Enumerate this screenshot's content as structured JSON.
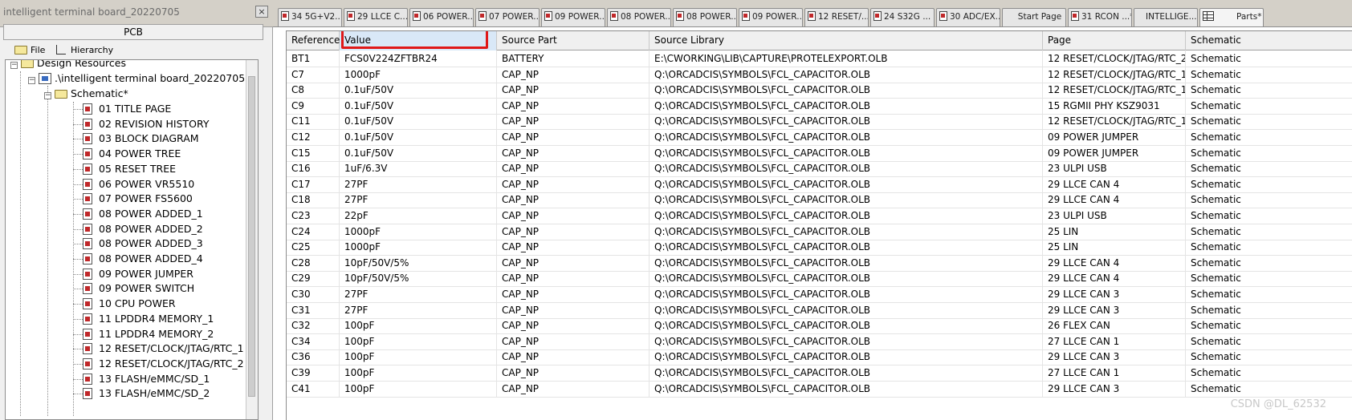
{
  "panel": {
    "title": "intelligent terminal board_20220705",
    "close_glyph": "×",
    "pcb_tab": "PCB",
    "tabs": {
      "file": "File",
      "hierarchy": "Hierarchy"
    }
  },
  "tree": {
    "design_resources": "Design Resources",
    "dsn": ".\\intelligent terminal board_20220705.dsn",
    "schematic": "Schematic*",
    "pages": [
      "01 TITLE PAGE",
      "02 REVISION HISTORY",
      "03 BLOCK DIAGRAM",
      "04 POWER TREE",
      "05 RESET TREE",
      "06 POWER VR5510",
      "07 POWER FS5600",
      "08 POWER ADDED_1",
      "08 POWER ADDED_2",
      "08 POWER ADDED_3",
      "08 POWER ADDED_4",
      "09 POWER JUMPER",
      "09 POWER SWITCH",
      "10 CPU POWER",
      "11 LPDDR4 MEMORY_1",
      "11 LPDDR4 MEMORY_2",
      "12 RESET/CLOCK/JTAG/RTC_1",
      "12 RESET/CLOCK/JTAG/RTC_2",
      "13 FLASH/eMMC/SD_1",
      "13 FLASH/eMMC/SD_2"
    ]
  },
  "doc_tabs": [
    {
      "label": "34 5G+V2...",
      "icon": true
    },
    {
      "label": "29 LLCE C...",
      "icon": true
    },
    {
      "label": "06 POWER...",
      "icon": true
    },
    {
      "label": "07 POWER...",
      "icon": true
    },
    {
      "label": "09 POWER...",
      "icon": true
    },
    {
      "label": "08 POWER...",
      "icon": true
    },
    {
      "label": "08 POWER...",
      "icon": true
    },
    {
      "label": "09 POWER...",
      "icon": true
    },
    {
      "label": "12 RESET/...",
      "icon": true
    },
    {
      "label": "24 S32G ...",
      "icon": true
    },
    {
      "label": "30 ADC/EX...",
      "icon": true
    },
    {
      "label": "Start Page",
      "icon": false
    },
    {
      "label": "31 RCON ...*",
      "icon": true
    },
    {
      "label": "INTELLIGE...*",
      "icon": false
    },
    {
      "label": "Parts*",
      "icon": false,
      "grid": true
    }
  ],
  "table": {
    "columns": [
      "Reference",
      "Value",
      "Source Part",
      "Source Library",
      "Page",
      "Schematic"
    ],
    "rows": [
      [
        "BT1",
        "FCS0V224ZFTBR24",
        "BATTERY",
        "E:\\CWORKING\\LIB\\CAPTURE\\PROTELEXPORT.OLB",
        "12 RESET/CLOCK/JTAG/RTC_2",
        "Schematic"
      ],
      [
        "C7",
        "1000pF",
        "CAP_NP",
        "Q:\\ORCADCIS\\SYMBOLS\\FCL_CAPACITOR.OLB",
        "12 RESET/CLOCK/JTAG/RTC_1",
        "Schematic"
      ],
      [
        "C8",
        "0.1uF/50V",
        "CAP_NP",
        "Q:\\ORCADCIS\\SYMBOLS\\FCL_CAPACITOR.OLB",
        "12 RESET/CLOCK/JTAG/RTC_1",
        "Schematic"
      ],
      [
        "C9",
        "0.1uF/50V",
        "CAP_NP",
        "Q:\\ORCADCIS\\SYMBOLS\\FCL_CAPACITOR.OLB",
        "15 RGMII PHY KSZ9031",
        "Schematic"
      ],
      [
        "C11",
        "0.1uF/50V",
        "CAP_NP",
        "Q:\\ORCADCIS\\SYMBOLS\\FCL_CAPACITOR.OLB",
        "12 RESET/CLOCK/JTAG/RTC_1",
        "Schematic"
      ],
      [
        "C12",
        "0.1uF/50V",
        "CAP_NP",
        "Q:\\ORCADCIS\\SYMBOLS\\FCL_CAPACITOR.OLB",
        "09 POWER JUMPER",
        "Schematic"
      ],
      [
        "C15",
        "0.1uF/50V",
        "CAP_NP",
        "Q:\\ORCADCIS\\SYMBOLS\\FCL_CAPACITOR.OLB",
        "09 POWER JUMPER",
        "Schematic"
      ],
      [
        "C16",
        "1uF/6.3V",
        "CAP_NP",
        "Q:\\ORCADCIS\\SYMBOLS\\FCL_CAPACITOR.OLB",
        "23 ULPI USB",
        "Schematic"
      ],
      [
        "C17",
        "27PF",
        "CAP_NP",
        "Q:\\ORCADCIS\\SYMBOLS\\FCL_CAPACITOR.OLB",
        "29 LLCE CAN 4",
        "Schematic"
      ],
      [
        "C18",
        "27PF",
        "CAP_NP",
        "Q:\\ORCADCIS\\SYMBOLS\\FCL_CAPACITOR.OLB",
        "29 LLCE CAN 4",
        "Schematic"
      ],
      [
        "C23",
        "22pF",
        "CAP_NP",
        "Q:\\ORCADCIS\\SYMBOLS\\FCL_CAPACITOR.OLB",
        "23 ULPI USB",
        "Schematic"
      ],
      [
        "C24",
        "1000pF",
        "CAP_NP",
        "Q:\\ORCADCIS\\SYMBOLS\\FCL_CAPACITOR.OLB",
        "25 LIN",
        "Schematic"
      ],
      [
        "C25",
        "1000pF",
        "CAP_NP",
        "Q:\\ORCADCIS\\SYMBOLS\\FCL_CAPACITOR.OLB",
        "25 LIN",
        "Schematic"
      ],
      [
        "C28",
        "10pF/50V/5%",
        "CAP_NP",
        "Q:\\ORCADCIS\\SYMBOLS\\FCL_CAPACITOR.OLB",
        "29 LLCE CAN 4",
        "Schematic"
      ],
      [
        "C29",
        "10pF/50V/5%",
        "CAP_NP",
        "Q:\\ORCADCIS\\SYMBOLS\\FCL_CAPACITOR.OLB",
        "29 LLCE CAN 4",
        "Schematic"
      ],
      [
        "C30",
        "27PF",
        "CAP_NP",
        "Q:\\ORCADCIS\\SYMBOLS\\FCL_CAPACITOR.OLB",
        "29 LLCE CAN 3",
        "Schematic"
      ],
      [
        "C31",
        "27PF",
        "CAP_NP",
        "Q:\\ORCADCIS\\SYMBOLS\\FCL_CAPACITOR.OLB",
        "29 LLCE CAN 3",
        "Schematic"
      ],
      [
        "C32",
        "100pF",
        "CAP_NP",
        "Q:\\ORCADCIS\\SYMBOLS\\FCL_CAPACITOR.OLB",
        "26 FLEX CAN",
        "Schematic"
      ],
      [
        "C34",
        "100pF",
        "CAP_NP",
        "Q:\\ORCADCIS\\SYMBOLS\\FCL_CAPACITOR.OLB",
        "27 LLCE CAN 1",
        "Schematic"
      ],
      [
        "C36",
        "100pF",
        "CAP_NP",
        "Q:\\ORCADCIS\\SYMBOLS\\FCL_CAPACITOR.OLB",
        "29 LLCE CAN 3",
        "Schematic"
      ],
      [
        "C39",
        "100pF",
        "CAP_NP",
        "Q:\\ORCADCIS\\SYMBOLS\\FCL_CAPACITOR.OLB",
        "27 LLCE CAN 1",
        "Schematic"
      ],
      [
        "C41",
        "100pF",
        "CAP_NP",
        "Q:\\ORCADCIS\\SYMBOLS\\FCL_CAPACITOR.OLB",
        "29 LLCE CAN 3",
        "Schematic"
      ]
    ]
  },
  "watermark": "CSDN @DL_62532",
  "colors": {
    "highlight": "#e01818",
    "selected_header": "#d9e8f7"
  }
}
